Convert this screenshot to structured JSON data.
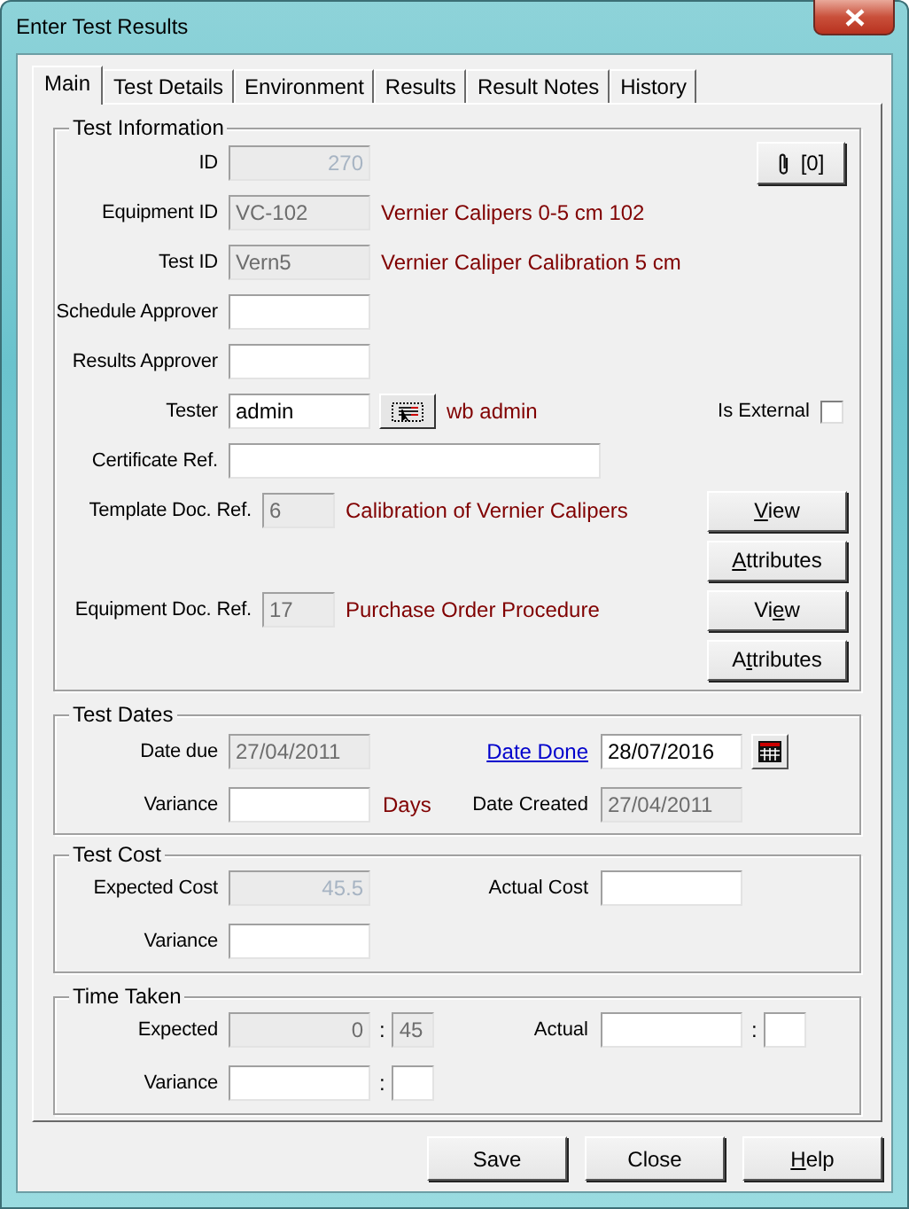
{
  "window": {
    "title": "Enter Test Results"
  },
  "tabs": [
    {
      "label": "Main",
      "selected": true
    },
    {
      "label": "Test Details",
      "selected": false
    },
    {
      "label": "Environment",
      "selected": false
    },
    {
      "label": "Results",
      "selected": false
    },
    {
      "label": "Result Notes",
      "selected": false
    },
    {
      "label": "History",
      "selected": false
    }
  ],
  "test_information": {
    "title": "Test Information",
    "attachments": "[0]",
    "id": {
      "label": "ID",
      "value": "270",
      "disabled": true
    },
    "equipment_id": {
      "label": "Equipment ID",
      "value": "VC-102",
      "disabled": true,
      "description": "Vernier Calipers 0-5 cm 102"
    },
    "test_id": {
      "label": "Test ID",
      "value": "Vern5",
      "disabled": true,
      "description": "Vernier Caliper Calibration 5 cm"
    },
    "schedule_approver": {
      "label": "Schedule Approver",
      "disabled": false
    },
    "results_approver": {
      "label": "Results Approver",
      "disabled": false
    },
    "tester": {
      "label": "Tester",
      "value": "admin",
      "disabled": false,
      "description": "wb admin"
    },
    "is_external": {
      "label": "Is External",
      "checked": false
    },
    "certificate_ref": {
      "label": "Certificate Ref.",
      "disabled": false
    },
    "template_doc_ref": {
      "label": "Template Doc. Ref.",
      "value": "6",
      "disabled": true,
      "description": "Calibration of Vernier Calipers",
      "buttons": [
        {
          "label": "View"
        },
        {
          "label": "Attributes"
        }
      ]
    },
    "equipment_doc_ref": {
      "label": "Equipment Doc. Ref.",
      "value": "17",
      "disabled": true,
      "description": "Purchase Order Procedure",
      "buttons": [
        {
          "label": "View"
        },
        {
          "label": "Attributes"
        }
      ]
    }
  },
  "test_dates": {
    "title": "Test Dates",
    "date_due": {
      "label": "Date due",
      "value": "27/04/2011",
      "disabled": true
    },
    "date_done": {
      "label": "Date Done",
      "value": "28/07/2016",
      "disabled": false
    },
    "variance": {
      "label": "Variance",
      "disabled": false,
      "unit": "Days"
    },
    "date_created": {
      "label": "Date Created",
      "value": "27/04/2011",
      "disabled": true
    }
  },
  "test_cost": {
    "title": "Test Cost",
    "expected_cost": {
      "label": "Expected Cost",
      "value": "45.5",
      "disabled": true
    },
    "actual_cost": {
      "label": "Actual Cost",
      "disabled": false
    },
    "variance": {
      "label": "Variance",
      "disabled": false
    }
  },
  "time_taken": {
    "title": "Time Taken",
    "expected": {
      "label": "Expected",
      "hours": "0",
      "separator": ":",
      "minutes": "45",
      "disabled": true
    },
    "actual": {
      "label": "Actual",
      "separator": ":",
      "disabled": false
    },
    "variance": {
      "label": "Variance",
      "separator": ":",
      "disabled": false
    }
  },
  "buttons": [
    {
      "label": "Save"
    },
    {
      "label": "Close"
    },
    {
      "label": "Help"
    }
  ]
}
